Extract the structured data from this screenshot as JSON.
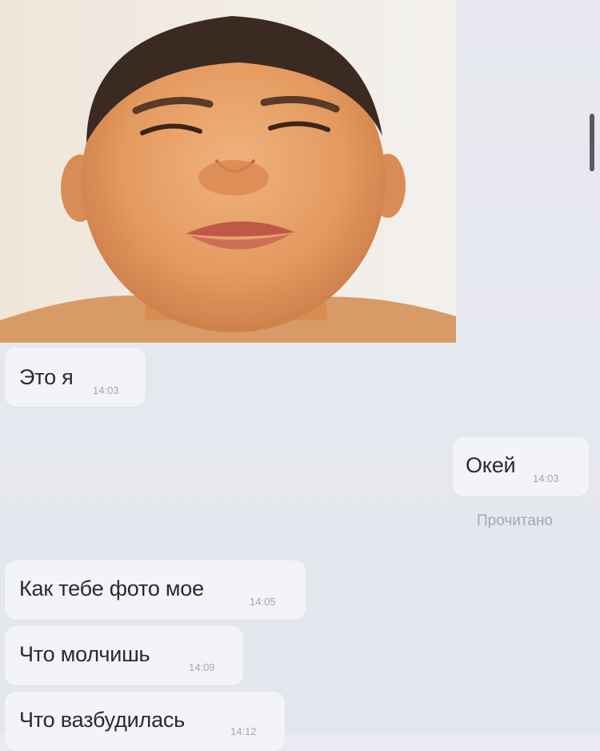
{
  "chat": {
    "messages": [
      {
        "id": "m1",
        "direction": "incoming",
        "text": "Это я",
        "time": "14:03"
      },
      {
        "id": "m2",
        "direction": "outgoing",
        "text": "Окей",
        "time": "14:03",
        "status": "Прочитано"
      },
      {
        "id": "m3",
        "direction": "incoming",
        "text": "Как тебе фото мое",
        "time": "14:05"
      },
      {
        "id": "m4",
        "direction": "incoming",
        "text": "Что молчишь",
        "time": "14:09"
      },
      {
        "id": "m5",
        "direction": "incoming",
        "text": "Что вазбудилась",
        "time": "14:12"
      }
    ]
  },
  "colors": {
    "background": "#e8e9f0",
    "bubble": "#f3f4f8",
    "text": "#2a2b2f",
    "meta": "#a3a5ad"
  }
}
